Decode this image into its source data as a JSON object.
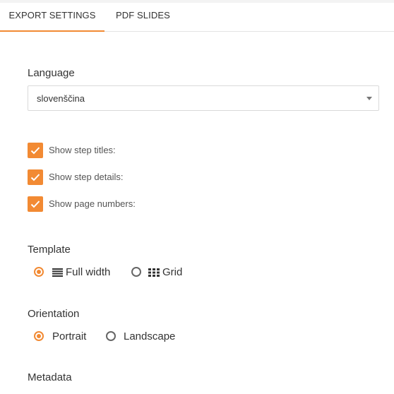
{
  "tabs": [
    {
      "label": "EXPORT SETTINGS",
      "active": true
    },
    {
      "label": "PDF SLIDES",
      "active": false
    }
  ],
  "language": {
    "label": "Language",
    "selected": "slovenščina"
  },
  "options": [
    {
      "label": "Show step titles:",
      "checked": true
    },
    {
      "label": "Show step details:",
      "checked": true
    },
    {
      "label": "Show page numbers:",
      "checked": true
    }
  ],
  "template": {
    "label": "Template",
    "choices": [
      {
        "label": "Full width",
        "icon": "list-icon",
        "selected": true
      },
      {
        "label": "Grid",
        "icon": "grid-icon",
        "selected": false
      }
    ]
  },
  "orientation": {
    "label": "Orientation",
    "choices": [
      {
        "label": "Portrait",
        "selected": true
      },
      {
        "label": "Landscape",
        "selected": false
      }
    ]
  },
  "metadata": {
    "label": "Metadata"
  },
  "colors": {
    "accent": "#f28a33"
  }
}
